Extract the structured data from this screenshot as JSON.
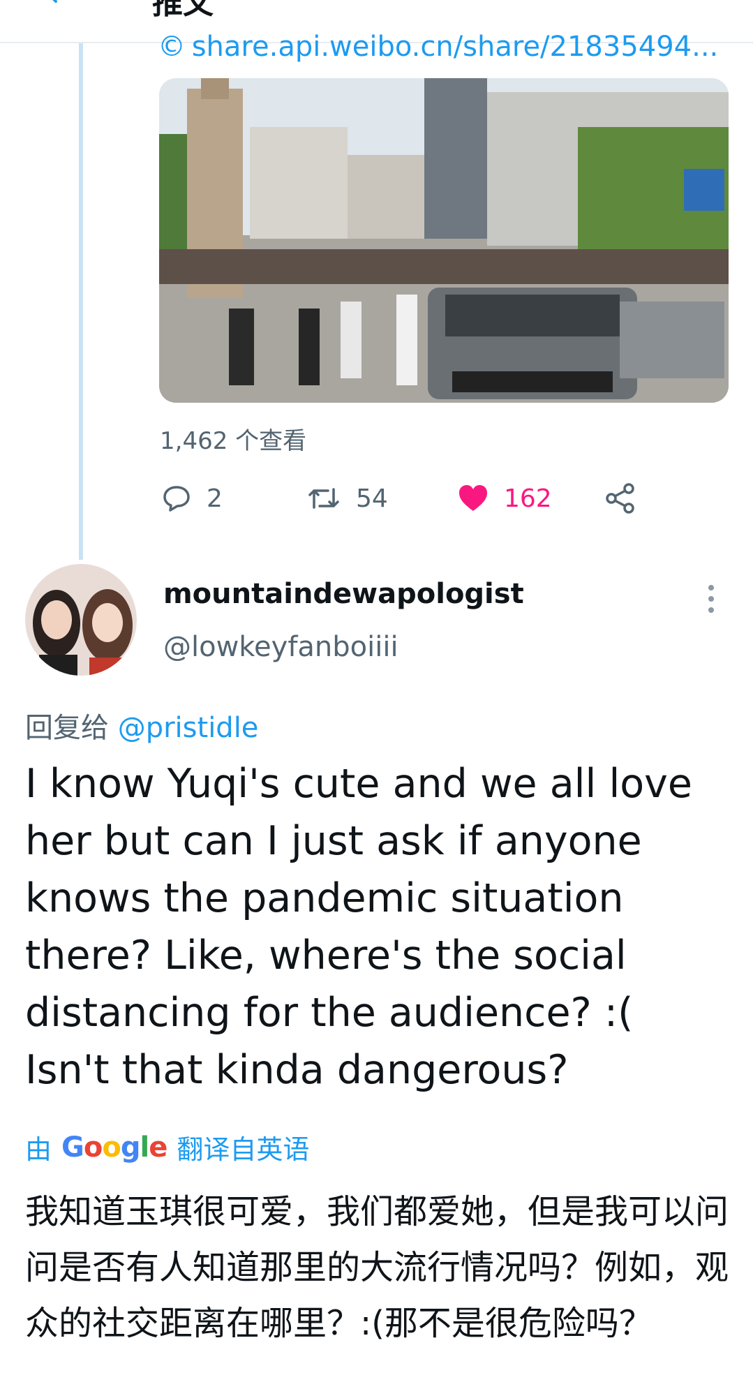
{
  "header": {
    "title": "推文"
  },
  "link": {
    "text": "share.api.weibo.cn/share/21835494..."
  },
  "tweet_stats": {
    "views": "1,462 个查看",
    "replies": "2",
    "retweets": "54",
    "likes": "162"
  },
  "reply_tweet": {
    "display_name": "mountaindewapologist",
    "handle": "@lowkeyfanboiiii",
    "reply_prefix": "回复给",
    "reply_mention": "@pristidle",
    "text": "I know Yuqi's cute and we all love her but can I just ask if anyone knows the pandemic situation there? Like, where's the social distancing for the audience? :( Isn't that kinda dangerous?",
    "translate_prefix": "由",
    "translate_suffix": "翻译自英语",
    "translated_text": "我知道玉琪很可爱，我们都爱她，但是我可以问问是否有人知道那里的大流行情况吗？例如，观众的社交距离在哪里？:(那不是很危险吗？"
  },
  "icons": {
    "back": "back-arrow-icon",
    "link": "link-icon",
    "reply": "reply-bubble-icon",
    "retweet": "retweet-icon",
    "like": "heart-icon",
    "share": "share-icon",
    "more": "more-vertical-icon"
  },
  "colors": {
    "accent": "#1d9bf0",
    "like": "#f91880",
    "secondary_text": "#536471",
    "thread_line": "#c9e3f5"
  }
}
